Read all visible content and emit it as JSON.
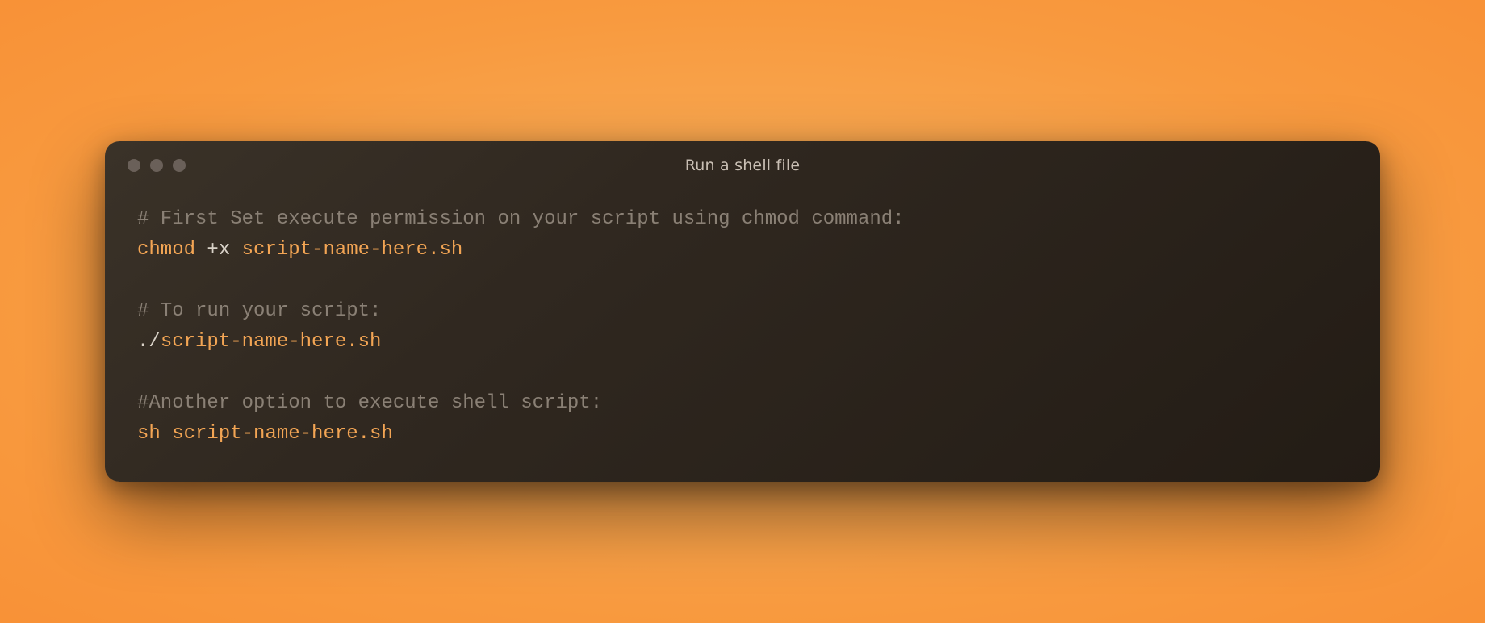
{
  "window": {
    "title": "Run a shell file"
  },
  "code": {
    "line1_comment": "# First Set execute permission on your script using chmod command:",
    "line2_cmd": "chmod",
    "line2_space_op": " +",
    "line2_arg": "x ",
    "line2_path": "script-name-here.sh",
    "blank1": "",
    "line3_comment": "# To run your script:",
    "line4_punct": "./",
    "line4_path": "script-name-here.sh",
    "blank2": "",
    "line5_comment": "#Another option to execute shell script:",
    "line6_cmd": "sh",
    "line6_space": " ",
    "line6_path": "script-name-here.sh"
  },
  "icons": {
    "close": "close-icon",
    "minimize": "minimize-icon",
    "zoom": "zoom-icon"
  }
}
